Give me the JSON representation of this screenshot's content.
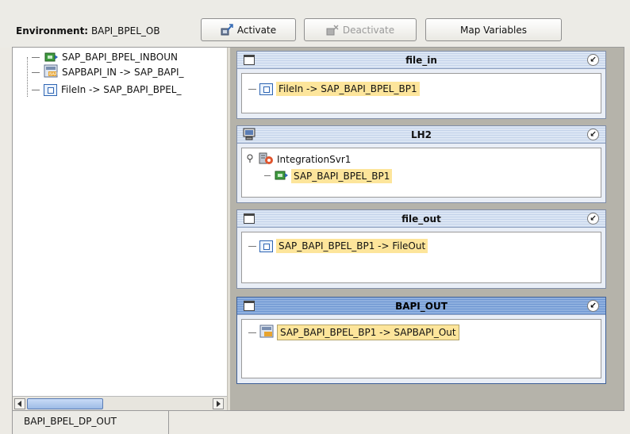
{
  "toolbar": {
    "environment_label": "Environment:",
    "environment_value": "BAPI_BPEL_OB",
    "activate_label": "Activate",
    "deactivate_label": "Deactivate",
    "map_variables_label": "Map Variables"
  },
  "tree": {
    "items": [
      {
        "label": "SAP_BAPI_BPEL_INBOUN",
        "icon": "bpel-process-icon"
      },
      {
        "label": "SAPBAPI_IN -> SAP_BAPI_",
        "icon": "sap-bapi-icon"
      },
      {
        "label": "FileIn -> SAP_BAPI_BPEL_",
        "icon": "file-connector-icon"
      }
    ]
  },
  "panels": {
    "file_in": {
      "title": "file_in",
      "item": "FileIn -> SAP_BAPI_BPEL_BP1"
    },
    "lh2": {
      "title": "LH2",
      "server": "IntegrationSvr1",
      "item": "SAP_BAPI_BPEL_BP1"
    },
    "file_out": {
      "title": "file_out",
      "item": "SAP_BAPI_BPEL_BP1 -> FileOut"
    },
    "bapi_out": {
      "title": "BAPI_OUT",
      "item": "SAP_BAPI_BPEL_BP1 -> SAPBAPI_Out"
    }
  },
  "bottom_tab": {
    "label": "BAPI_BPEL_DP_OUT"
  },
  "colors": {
    "highlight": "#fde59b",
    "active_title": "#7a9fd8",
    "canvas": "#b5b3aa"
  }
}
